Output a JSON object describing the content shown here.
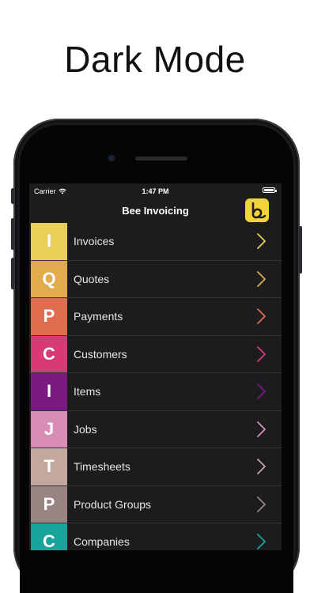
{
  "headline": "Dark Mode",
  "status": {
    "carrier": "Carrier",
    "time": "1:47 PM"
  },
  "nav": {
    "title": "Bee Invoicing"
  },
  "icons": {
    "wifi": "wifi-icon",
    "battery": "battery-icon",
    "logo": "bee-logo",
    "chevron": "chevron-right-icon"
  },
  "menu": [
    {
      "letter": "I",
      "label": "Invoices",
      "color": "#e8cf57"
    },
    {
      "letter": "Q",
      "label": "Quotes",
      "color": "#e2ac4d"
    },
    {
      "letter": "P",
      "label": "Payments",
      "color": "#df6d4d"
    },
    {
      "letter": "C",
      "label": "Customers",
      "color": "#d93a76"
    },
    {
      "letter": "I",
      "label": "Items",
      "color": "#7a1a82"
    },
    {
      "letter": "J",
      "label": "Jobs",
      "color": "#d88db5"
    },
    {
      "letter": "T",
      "label": "Timesheets",
      "color": "#c2a89f"
    },
    {
      "letter": "P",
      "label": "Product Groups",
      "color": "#9a8483"
    },
    {
      "letter": "C",
      "label": "Companies",
      "color": "#18a39b"
    }
  ]
}
